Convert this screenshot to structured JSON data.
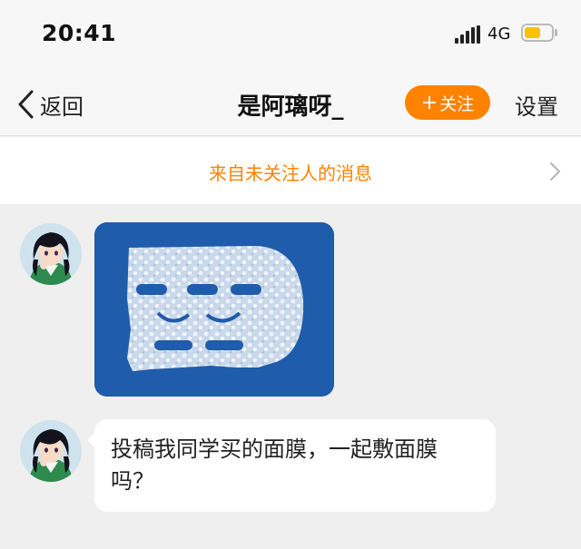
{
  "status_bar": {
    "time": "20:41",
    "network": "4G",
    "battery_level": 0.6,
    "battery_color": "#f5c400"
  },
  "nav": {
    "back_label": "返回",
    "title": "是阿璃呀_",
    "follow_label": "关注",
    "follow_icon": "plus-icon",
    "settings_label": "设置",
    "accent_color": "#ff8200"
  },
  "notice": {
    "text": "来自未关注人的消息",
    "icon": "chevron-right-icon"
  },
  "messages": [
    {
      "type": "image",
      "sender": "是阿璃呀_",
      "image_desc": "sheet-mask-photo"
    },
    {
      "type": "text",
      "sender": "是阿璃呀_",
      "text": "投稿我同学买的面膜，一起敷面膜吗？"
    }
  ]
}
